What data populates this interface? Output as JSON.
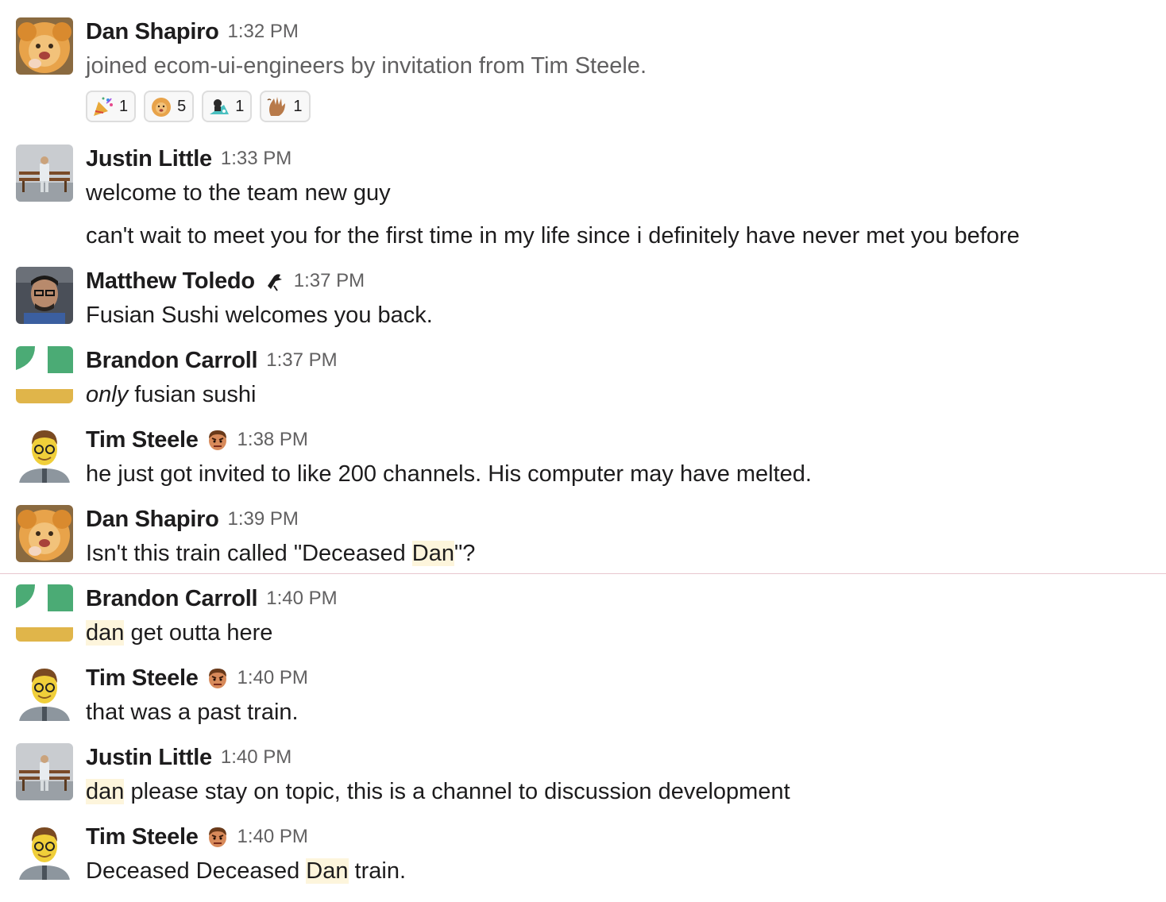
{
  "messages": [
    {
      "author": "Dan Shapiro",
      "time": "1:32 PM",
      "lines": [
        "joined ecom-ui-engineers by invitation from Tim Steele."
      ],
      "reactions": [
        {
          "emoji": "party-popper",
          "count": "1"
        },
        {
          "emoji": "lion-face",
          "count": "5"
        },
        {
          "emoji": "shark-rider",
          "count": "1"
        },
        {
          "emoji": "waving-hand",
          "count": "1"
        }
      ]
    },
    {
      "author": "Justin Little",
      "time": "1:33 PM",
      "lines": [
        "welcome to the team new guy",
        "can't wait to meet you for the first time in my life since i definitely have never met you before"
      ]
    },
    {
      "author": "Matthew Toledo",
      "status_emoji": "crow",
      "time": "1:37 PM",
      "text": "Fusian Sushi welcomes you back."
    },
    {
      "author": "Brandon Carroll",
      "time": "1:37 PM",
      "text_italic": "only",
      "text_rest": " fusian sushi"
    },
    {
      "author": "Tim Steele",
      "status_emoji": "angry-face",
      "time": "1:38 PM",
      "text": "he just got invited to like 200 channels. His computer may have melted."
    },
    {
      "author": "Dan Shapiro",
      "time": "1:39 PM",
      "text_before": "Isn't this train called \"Deceased ",
      "text_highlight": "Dan",
      "text_after": "\"?"
    },
    {
      "author": "Brandon Carroll",
      "time": "1:40 PM",
      "text_highlight": "dan",
      "text_after": " get outta here"
    },
    {
      "author": "Tim Steele",
      "status_emoji": "angry-face",
      "time": "1:40 PM",
      "text": "that was a past train."
    },
    {
      "author": "Justin Little",
      "time": "1:40 PM",
      "text_highlight": "dan",
      "text_after": " please stay on topic, this is a channel to discussion development"
    },
    {
      "author": "Tim Steele",
      "status_emoji": "angry-face",
      "time": "1:40 PM",
      "text_before": "Deceased Deceased ",
      "text_highlight": "Dan",
      "text_after": " train."
    }
  ],
  "colors": {
    "highlight": "#fdf5dc",
    "new_divider": "#e8c7cf",
    "timestamp": "#616061"
  }
}
